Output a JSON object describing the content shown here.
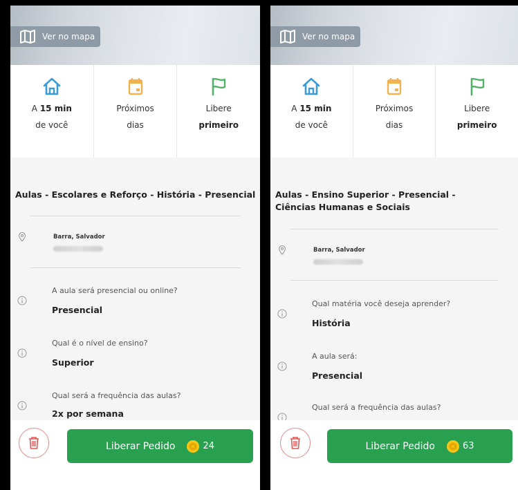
{
  "map_label": "Ver no mapa",
  "features": {
    "distance_prefix": "A",
    "distance_value": "15 min",
    "distance_suffix": "de você",
    "days_line1": "Próximos",
    "days_line2": "dias",
    "free_line1": "Libere",
    "free_line2": "primeiro"
  },
  "colors": {
    "green": "#28a050",
    "house_blue": "#3a9bd8",
    "calendar_orange": "#f2b24f",
    "flag_green": "#52b26a",
    "trash_red": "#e05555",
    "coin_yellow": "#f5c518"
  },
  "panels": [
    {
      "title": "Aulas - Escolares e Reforço - História - Presencial",
      "location": "Barra, Salvador",
      "questions": [
        {
          "label": "A aula será presencial ou online?",
          "value": "Presencial"
        },
        {
          "label": "Qual é o nível de ensino?",
          "value": "Superior"
        },
        {
          "label": "Qual será a frequência das aulas?",
          "value": "2x por semana"
        }
      ],
      "button_label": "Liberar Pedido",
      "coins": "24"
    },
    {
      "title": "Aulas - Ensino Superior - Presencial - Ciências Humanas e Sociais",
      "location": "Barra, Salvador",
      "questions": [
        {
          "label": "Qual matéria você deseja aprender?",
          "value": "História"
        },
        {
          "label": "A aula será:",
          "value": "Presencial"
        },
        {
          "label": "Qual será a frequência das aulas?",
          "value": ""
        }
      ],
      "button_label": "Liberar Pedido",
      "coins": "63"
    }
  ]
}
